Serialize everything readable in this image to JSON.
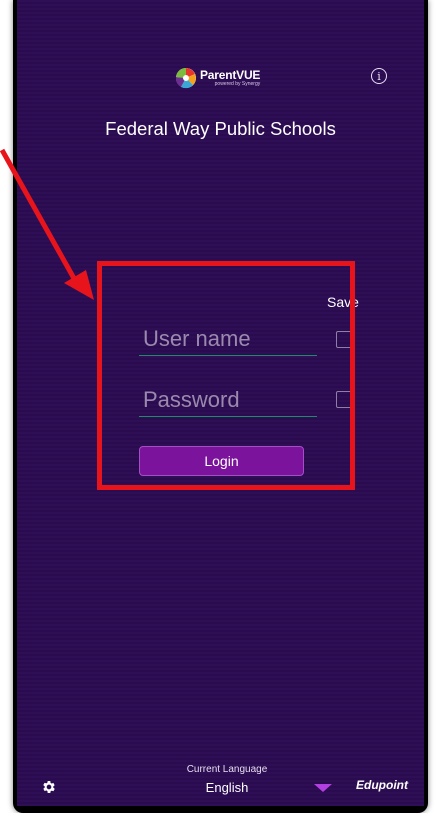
{
  "header": {
    "brand_name": "ParentVUE",
    "brand_tagline": "powered by Synergy",
    "district_name": "Federal Way Public Schools"
  },
  "login": {
    "save_label": "Save",
    "username_placeholder": "User name",
    "password_placeholder": "Password",
    "login_label": "Login"
  },
  "footer": {
    "language_label": "Current Language",
    "language_value": "English",
    "vendor_name": "Edupoint"
  },
  "icons": {
    "info": "info-icon",
    "settings": "gear-icon",
    "dropdown": "chevron-down-icon"
  },
  "colors": {
    "background": "#2e0e55",
    "accent": "#7b139c",
    "highlight_frame": "#e8141c",
    "dropdown": "#b23fe0"
  }
}
